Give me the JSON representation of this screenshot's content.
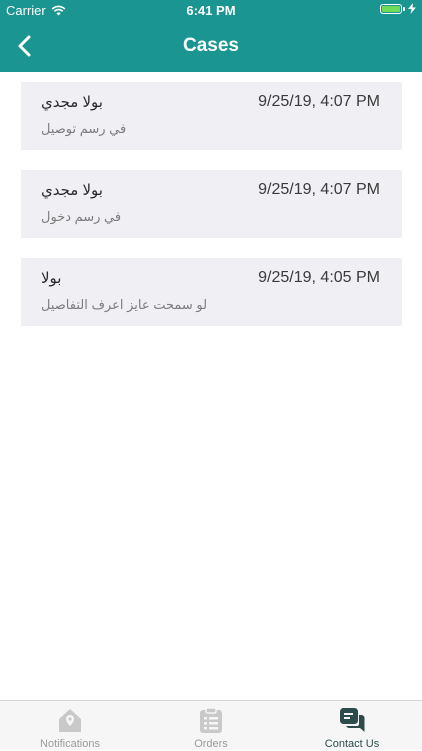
{
  "status_bar": {
    "carrier": "Carrier",
    "time": "6:41 PM"
  },
  "nav": {
    "title": "Cases",
    "color": "#1a9591"
  },
  "cases": [
    {
      "name": "بولا مجدي",
      "date": "9/25/19, 4:07 PM",
      "message": "في رسم توصيل"
    },
    {
      "name": "بولا مجدي",
      "date": "9/25/19, 4:07 PM",
      "message": "في رسم دخول"
    },
    {
      "name": "بولا",
      "date": "9/25/19, 4:05 PM",
      "message": "لو سمحت عايز اعرف التفاصيل"
    }
  ],
  "tabs": [
    {
      "label": "Notifications",
      "icon": "notification-pin-icon",
      "active": false
    },
    {
      "label": "Orders",
      "icon": "orders-clipboard-icon",
      "active": false
    },
    {
      "label": "Contact Us",
      "icon": "chat-bubbles-icon",
      "active": true
    }
  ]
}
